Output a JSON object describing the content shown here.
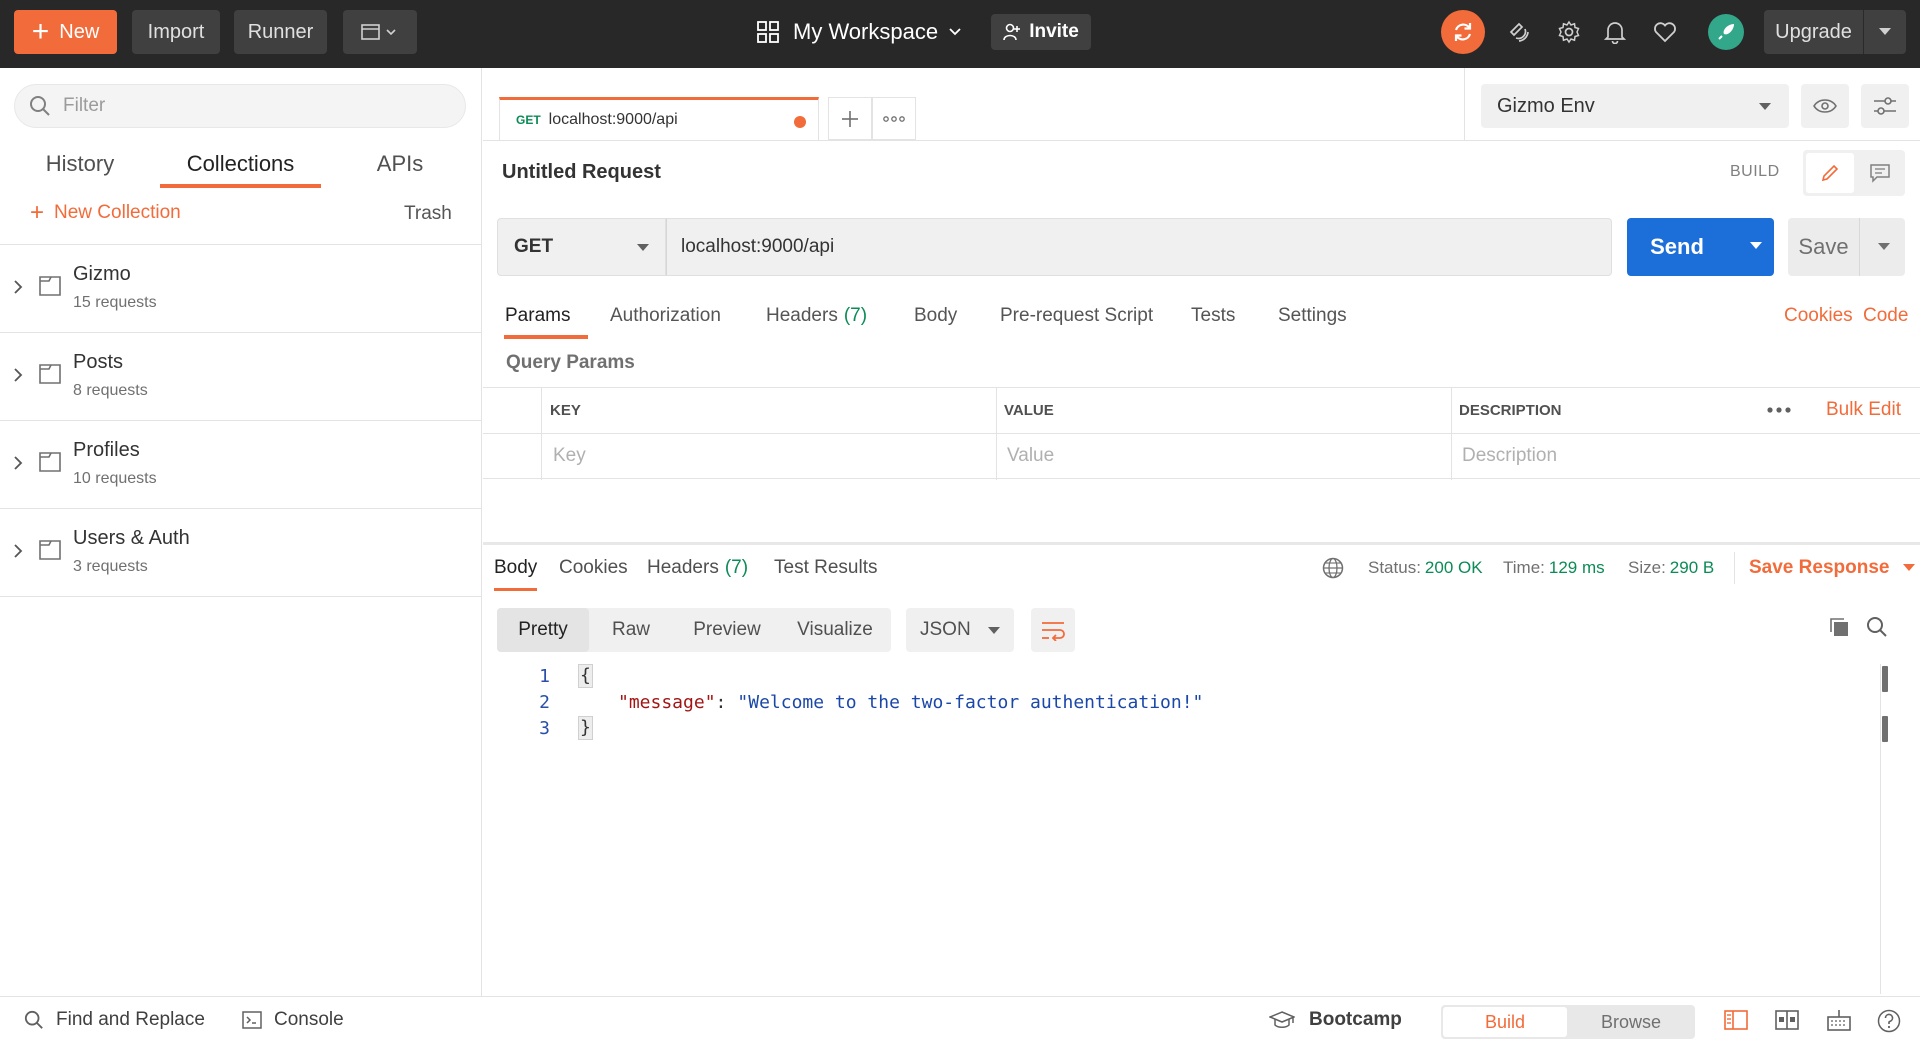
{
  "header": {
    "new_label": "New",
    "import_label": "Import",
    "runner_label": "Runner",
    "workspace_label": "My Workspace",
    "invite_label": "Invite",
    "upgrade_label": "Upgrade",
    "accent": "#f26b3a"
  },
  "sidebar": {
    "filter_placeholder": "Filter",
    "tabs": [
      {
        "label": "History"
      },
      {
        "label": "Collections"
      },
      {
        "label": "APIs"
      }
    ],
    "active_tab": "Collections",
    "new_collection_label": "New Collection",
    "trash_label": "Trash",
    "collections": [
      {
        "name": "Gizmo",
        "count": "15 requests"
      },
      {
        "name": "Posts",
        "count": "8 requests"
      },
      {
        "name": "Profiles",
        "count": "10 requests"
      },
      {
        "name": "Users & Auth",
        "count": "3 requests"
      }
    ]
  },
  "tab": {
    "method": "GET",
    "url": "localhost:9000/api"
  },
  "environment": {
    "selected": "Gizmo Env"
  },
  "request": {
    "title": "Untitled Request",
    "mode_label": "BUILD",
    "method": "GET",
    "url": "localhost:9000/api",
    "send_label": "Send",
    "save_label": "Save",
    "tabs": [
      {
        "label": "Params"
      },
      {
        "label": "Authorization"
      },
      {
        "label": "Headers",
        "count": "(7)"
      },
      {
        "label": "Body"
      },
      {
        "label": "Pre-request Script"
      },
      {
        "label": "Tests"
      },
      {
        "label": "Settings"
      }
    ],
    "cookies_link": "Cookies",
    "code_link": "Code",
    "query_params_title": "Query Params",
    "params_table": {
      "headers": [
        "KEY",
        "VALUE",
        "DESCRIPTION"
      ],
      "placeholders": [
        "Key",
        "Value",
        "Description"
      ],
      "bulk_edit_label": "Bulk Edit"
    }
  },
  "response": {
    "tabs": [
      {
        "label": "Body"
      },
      {
        "label": "Cookies"
      },
      {
        "label": "Headers",
        "count": "(7)"
      },
      {
        "label": "Test Results"
      }
    ],
    "status_label": "Status:",
    "status_value": "200 OK",
    "time_label": "Time:",
    "time_value": "129 ms",
    "size_label": "Size:",
    "size_value": "290 B",
    "save_response_label": "Save Response",
    "formats": [
      "Pretty",
      "Raw",
      "Preview",
      "Visualize"
    ],
    "active_format": "Pretty",
    "language": "JSON",
    "body_lines": [
      {
        "no": "1",
        "open": "{"
      },
      {
        "no": "2",
        "key": "\"message\"",
        "colon": ":",
        "value": "\"Welcome to the two-factor authentication!\""
      },
      {
        "no": "3",
        "close": "}"
      }
    ]
  },
  "statusbar": {
    "find_replace_label": "Find and Replace",
    "console_label": "Console",
    "bootcamp_label": "Bootcamp",
    "build_label": "Build",
    "browse_label": "Browse"
  }
}
